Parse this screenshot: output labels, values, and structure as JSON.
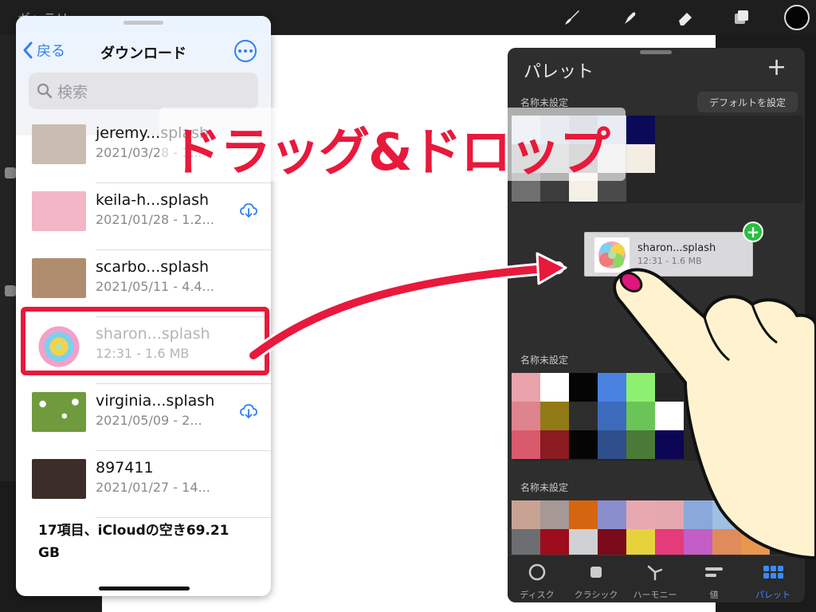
{
  "app": {
    "gallery_label": "ギャラリー"
  },
  "files_sheet": {
    "back_label": "戻る",
    "title": "ダウンロード",
    "search_placeholder": "検索",
    "items": [
      {
        "name": "jeremy...splash",
        "meta": "2021/03/28 - 1...",
        "thumb_color": "#c9bdb2",
        "cloud": false
      },
      {
        "name": "keila-h...splash",
        "meta": "2021/01/28 - 1.2...",
        "thumb_color": "#f2b6c6",
        "cloud": true
      },
      {
        "name": "scarbo...splash",
        "meta": "2021/05/11 - 4.4...",
        "thumb_color": "#b18d70",
        "cloud": false
      },
      {
        "name": "sharon...splash",
        "meta": "12:31 - 1.6 MB",
        "thumb_color": "#ffffff",
        "cloud": false
      },
      {
        "name": "virginia...splash",
        "meta": "2021/05/09 - 2...",
        "thumb_color": "#6f9a3e",
        "cloud": true
      },
      {
        "name": "897411",
        "meta": "2021/01/27 - 14...",
        "thumb_color": "#3c2d28",
        "cloud": false
      }
    ],
    "footer": "17項目、iCloudの空き69.21 GB"
  },
  "caption": "ドラッグ&ドロップ",
  "drag_card": {
    "name": "sharon...splash",
    "meta": "12:31 - 1.6 MB"
  },
  "palette": {
    "title": "パレット",
    "default_button": "デフォルトを設定",
    "sections": [
      {
        "label": "名称未設定",
        "rows": [
          [
            "#d5e0ec",
            "#c3ccd8",
            "#aab5c4",
            "#c5d0e0",
            "#0b0a59",
            "#262626",
            "#262626",
            "#262626",
            "#262626",
            "#262626"
          ],
          [
            "#a7a7a7",
            "#b9b9b9",
            "#9c9c9c",
            "#e2e2e2",
            "#f3ede3",
            "#262626",
            "#262626",
            "#262626",
            "#262626",
            "#262626"
          ],
          [
            "#6f6f6f",
            "#3c3c3c",
            "#f5f0e6",
            "#4a4a4a",
            "#262626",
            "#262626",
            "#262626",
            "#262626",
            "#262626",
            "#262626"
          ]
        ]
      },
      {
        "label": "名称未設定",
        "rows": [
          [
            "#e9a3ab",
            "#ffffff",
            "#050505",
            "#4a82e2",
            "#8df071",
            "#262626",
            "#262626",
            "#262626",
            "#262626",
            "#262626"
          ],
          [
            "#df838f",
            "#927b17",
            "#2d2d2d",
            "#3c6bbc",
            "#6bc458",
            "#ffffff",
            "#262626",
            "#262626",
            "#262626",
            "#262626"
          ],
          [
            "#d95a6c",
            "#8a1c22",
            "#050505",
            "#2e4f8c",
            "#4b7a37",
            "#0c0654",
            "#262626",
            "#262626",
            "#262626",
            "#262626"
          ]
        ]
      },
      {
        "label": "名称未設定",
        "rows": [
          [
            "#c8a394",
            "#a59895",
            "#d6650f",
            "#8b8ecd",
            "#e8a8b0",
            "#e4a7ae",
            "#8ba8da",
            "#9ec0e1",
            "#ce7a57",
            "#d3c6c2"
          ],
          [
            "#6d6e72",
            "#9d0d1c",
            "#cfd1d4",
            "#7a0a19",
            "#e6d33c",
            "#e43b7b",
            "#c55dc6",
            "#df8b5b",
            "#e8974c",
            "#222222"
          ]
        ]
      }
    ],
    "tabs": [
      {
        "label": "ディスク",
        "active": false
      },
      {
        "label": "クラシック",
        "active": false
      },
      {
        "label": "ハーモニー",
        "active": false
      },
      {
        "label": "値",
        "active": false
      },
      {
        "label": "パレット",
        "active": true
      }
    ]
  }
}
